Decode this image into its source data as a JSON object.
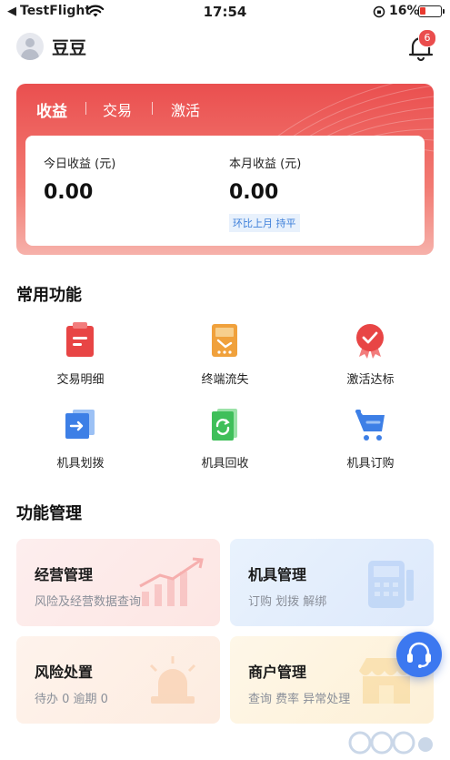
{
  "status_bar": {
    "back_glyph": "◀",
    "carrier": "TestFlight",
    "time": "17:54",
    "battery": "16%"
  },
  "header": {
    "username": "豆豆",
    "notification_count": "6"
  },
  "earnings": {
    "tabs": [
      "收益",
      "交易",
      "激活"
    ],
    "today_label": "今日收益 (元)",
    "today_value": "0.00",
    "month_label": "本月收益 (元)",
    "month_value": "0.00",
    "month_compare": "环比上月 持平"
  },
  "common_functions": {
    "title": "常用功能",
    "items": [
      {
        "label": "交易明细",
        "icon": "clipboard-icon",
        "color": "#e84545"
      },
      {
        "label": "终端流失",
        "icon": "terminal-loss-icon",
        "color": "#f0a13c"
      },
      {
        "label": "激活达标",
        "icon": "medal-icon",
        "color": "#e84545"
      },
      {
        "label": "机具划拨",
        "icon": "transfer-icon",
        "color": "#3d7fe6"
      },
      {
        "label": "机具回收",
        "icon": "recycle-icon",
        "color": "#3fbf5a"
      },
      {
        "label": "机具订购",
        "icon": "cart-icon",
        "color": "#3d7fe6"
      }
    ]
  },
  "management": {
    "title": "功能管理",
    "cards": [
      {
        "title": "经营管理",
        "subtitle": "风险及经营数据查询",
        "icon": "trend-chart-icon"
      },
      {
        "title": "机具管理",
        "subtitle": "订购 划拨 解绑",
        "icon": "pos-terminal-icon"
      },
      {
        "title": "风险处置",
        "subtitle": "待办 0   逾期 0",
        "icon": "alarm-light-icon"
      },
      {
        "title": "商户管理",
        "subtitle": "查询 费率 异常处理",
        "icon": "shop-icon"
      }
    ]
  },
  "colors": {
    "accent_red": "#ea4f4f",
    "accent_blue": "#3c78f0"
  }
}
